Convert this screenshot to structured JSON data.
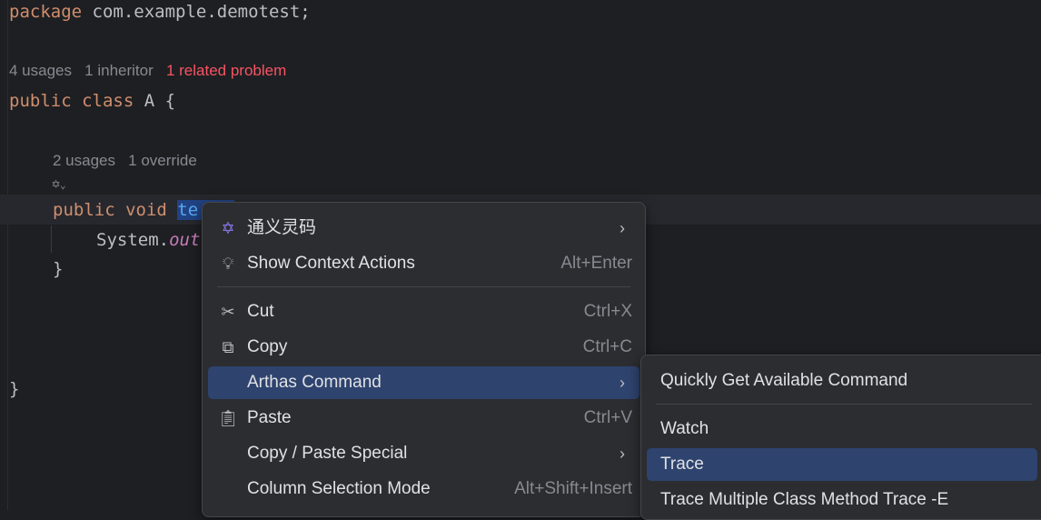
{
  "editor": {
    "package_kw": "package",
    "package_name": " com.example.demotest;",
    "class_hints": {
      "usages": "4 usages",
      "inheritor": "1 inheritor",
      "problem": "1 related problem"
    },
    "class_kw": "public class",
    "class_rest": " A {",
    "method_hints": {
      "usages": "2 usages",
      "override": "1 override"
    },
    "method_kw": "public void",
    "method_name": "te",
    "body_text": "System.",
    "body_field": "out",
    "close_method": "}",
    "close_class": "}"
  },
  "context_menu": {
    "items": [
      {
        "label": "通义灵码",
        "icon": "tongyi-lingma-icon",
        "submenu": true
      },
      {
        "label": "Show Context Actions",
        "icon": "lightbulb-icon",
        "shortcut": "Alt+Enter"
      },
      {
        "label": "Cut",
        "icon": "scissors-icon",
        "shortcut": "Ctrl+X"
      },
      {
        "label": "Copy",
        "icon": "copy-icon",
        "shortcut": "Ctrl+C"
      },
      {
        "label": "Arthas Command",
        "submenu": true,
        "active": true
      },
      {
        "label": "Paste",
        "icon": "clipboard-icon",
        "shortcut": "Ctrl+V"
      },
      {
        "label": "Copy / Paste Special",
        "submenu": true
      },
      {
        "label": "Column Selection Mode",
        "shortcut": "Alt+Shift+Insert"
      }
    ]
  },
  "submenu": {
    "items": [
      {
        "label": "Quickly Get Available Command"
      },
      {
        "label": "Watch"
      },
      {
        "label": "Trace",
        "active": true
      },
      {
        "label": "Trace Multiple Class Method Trace -E"
      }
    ]
  },
  "colors": {
    "accent": "#2e436e",
    "keyword": "#cf8e6d",
    "error": "#f75464"
  }
}
